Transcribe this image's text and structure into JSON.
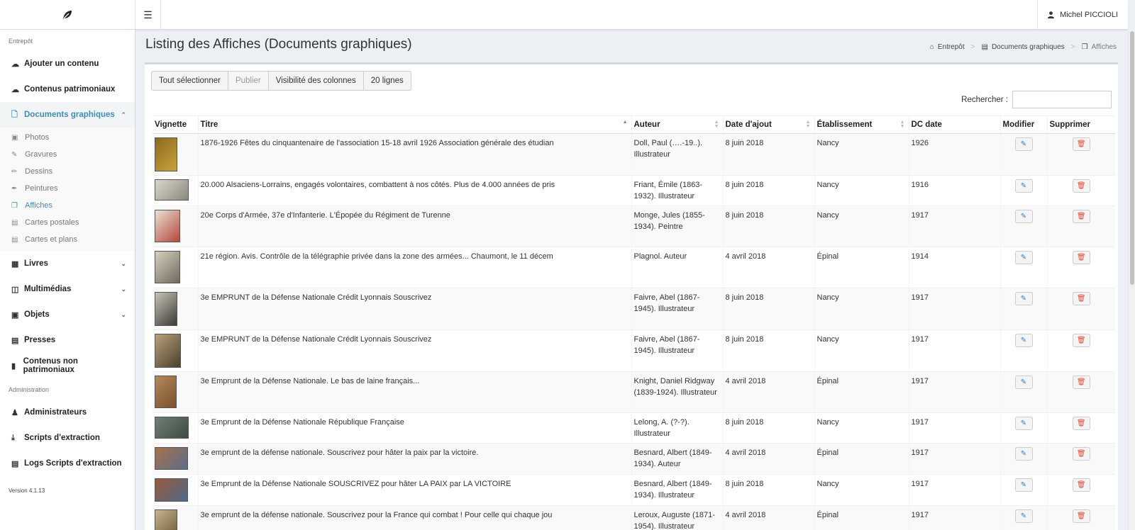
{
  "topbar": {
    "logo_icon": "leaf-icon",
    "menu_icon": "hamburger-icon",
    "user_icon": "user-icon",
    "user_name": "Michel PICCIOLI"
  },
  "sidebar": {
    "section1": "Entrepôt",
    "items": [
      {
        "label": "Ajouter un contenu",
        "icon": "cloud-upload-icon"
      },
      {
        "label": "Contenus patrimoniaux",
        "icon": "cloud-icon"
      },
      {
        "label": "Documents graphiques",
        "icon": "file-image-icon"
      }
    ],
    "subitems": [
      {
        "label": "Photos",
        "icon": "photo-icon"
      },
      {
        "label": "Gravures",
        "icon": "edit-icon"
      },
      {
        "label": "Dessins",
        "icon": "pencil-icon"
      },
      {
        "label": "Peintures",
        "icon": "paint-brush-icon"
      },
      {
        "label": "Affiches",
        "icon": "copy-icon"
      },
      {
        "label": "Cartes postales",
        "icon": "postcard-icon"
      },
      {
        "label": "Cartes et plans",
        "icon": "map-icon"
      }
    ],
    "items2": [
      {
        "label": "Livres",
        "icon": "book-icon"
      },
      {
        "label": "Multimédias",
        "icon": "film-icon"
      },
      {
        "label": "Objets",
        "icon": "archive-icon"
      },
      {
        "label": "Presses",
        "icon": "newspaper-icon"
      },
      {
        "label": "Contenus non patrimoniaux",
        "icon": "file-icon"
      }
    ],
    "section2": "Administration",
    "items3": [
      {
        "label": "Administrateurs",
        "icon": "user-icon"
      },
      {
        "label": "Scripts d'extraction",
        "icon": "download-icon"
      },
      {
        "label": "Logs Scripts d'extraction",
        "icon": "file-text-icon"
      }
    ],
    "version": "Version 4.1.13"
  },
  "header": {
    "title": "Listing des Affiches (Documents graphiques)",
    "breadcrumb": [
      "Entrepôt",
      "Documents graphiques",
      "Affiches"
    ]
  },
  "toolbar": {
    "select_all": "Tout sélectionner",
    "publish": "Publier",
    "columns": "Visibilité des colonnes",
    "rows": "20 lignes",
    "search_label": "Rechercher :",
    "search_value": ""
  },
  "table": {
    "columns": [
      "Vignette",
      "Titre",
      "Auteur",
      "Date d'ajout",
      "Établissement",
      "DC date",
      "Modifier",
      "Supprimer"
    ],
    "rows": [
      {
        "title": "1876-1926 Fêtes du cinquantenaire de l'association 15-18 avril 1926 Association générale des étudian",
        "author": "Doll, Paul (….-19..). Illustrateur",
        "date": "8 juin 2018",
        "place": "Nancy",
        "dc": "1926",
        "thumb_color": "#8a6b1f",
        "thumb_accent": "#c9a23a"
      },
      {
        "title": "20.000 Alsaciens-Lorrains, engagés volontaires, combattent à nos côtés. Plus de 4.000 années de pris",
        "author": "Friant, Émile (1863-1932). Illustrateur",
        "date": "8 juin 2018",
        "place": "Nancy",
        "dc": "1916",
        "thumb_color": "#d9d6cc",
        "thumb_accent": "#8c8a80"
      },
      {
        "title": "20e Corps d'Armée, 37e d'Infanterie. L'Épopée du Régiment de Turenne",
        "author": "Monge, Jules (1855-1934). Peintre",
        "date": "8 juin 2018",
        "place": "Nancy",
        "dc": "1917",
        "thumb_color": "#e8e2d4",
        "thumb_accent": "#b5463a"
      },
      {
        "title": "21e région. Avis. Contrôle de la télégraphie privée dans la zone des armées... Chaumont, le 11 décem",
        "author": "Plagnol. Auteur",
        "date": "4 avril 2018",
        "place": "Épinal",
        "dc": "1914",
        "thumb_color": "#d6cfbf",
        "thumb_accent": "#6f6a5e"
      },
      {
        "title": "3e EMPRUNT de la Défense Nationale Crédit Lyonnais Souscrivez",
        "author": "Faivre, Abel (1867-1945). Illustrateur",
        "date": "8 juin 2018",
        "place": "Nancy",
        "dc": "1917",
        "thumb_color": "#c8c3b6",
        "thumb_accent": "#3b3a36"
      },
      {
        "title": "3e EMPRUNT de la Défense Nationale Crédit Lyonnais Souscrivez",
        "author": "Faivre, Abel (1867-1945). Illustrateur",
        "date": "8 juin 2018",
        "place": "Nancy",
        "dc": "1917",
        "thumb_color": "#b9a27a",
        "thumb_accent": "#4a3f2c"
      },
      {
        "title": "3e Emprunt de la Défense Nationale. Le bas de laine français...",
        "author": "Knight, Daniel Ridgway (1839-1924). Illustrateur",
        "date": "4 avril 2018",
        "place": "Épinal",
        "dc": "1917",
        "thumb_color": "#b48a5a",
        "thumb_accent": "#7a4f2e"
      },
      {
        "title": "3e Emprunt de la Défense Nationale République Française",
        "author": "Lelong, A. (?-?). Illustrateur",
        "date": "8 juin 2018",
        "place": "Nancy",
        "dc": "1917",
        "thumb_color": "#6f7f72",
        "thumb_accent": "#3f4b45"
      },
      {
        "title": "3e emprunt de la défense nationale. Souscrivez pour hâter la paix par la victoire.",
        "author": "Besnard, Albert (1849-1934). Auteur",
        "date": "4 avril 2018",
        "place": "Épinal",
        "dc": "1917",
        "thumb_color": "#a8724a",
        "thumb_accent": "#5a6e8a"
      },
      {
        "title": "3e Emprunt de la Défense Nationale SOUSCRIVEZ pour hâter LA PAIX par LA VICTOIRE",
        "author": "Besnard, Albert (1849-1934). Illustrateur",
        "date": "8 juin 2018",
        "place": "Nancy",
        "dc": "1917",
        "thumb_color": "#9a5a3a",
        "thumb_accent": "#4e6a8c"
      },
      {
        "title": "3e emprunt de la défense nationale. Souscrivez pour la France qui combat ! Pour celle qui chaque jou",
        "author": "Leroux, Auguste (1871-1954). Illustrateur",
        "date": "4 avril 2018",
        "place": "Épinal",
        "dc": "1917",
        "thumb_color": "#c9b58e",
        "thumb_accent": "#6b5a3c"
      }
    ]
  },
  "colors": {
    "accent": "#3c8dbc",
    "danger": "#dd4b39",
    "edit": "#337ab7"
  }
}
